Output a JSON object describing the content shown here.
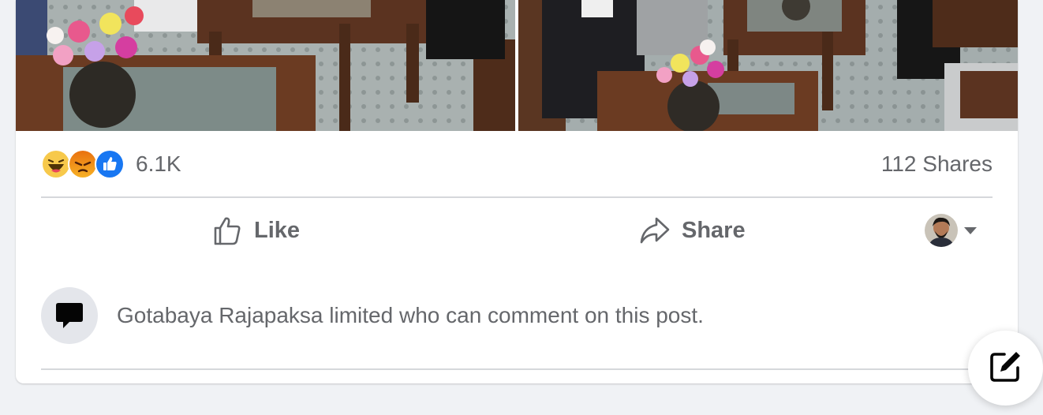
{
  "post": {
    "photos": [
      {
        "icon": "photo-meeting-room-left"
      },
      {
        "icon": "photo-meeting-room-right"
      }
    ],
    "reactions": {
      "icons": [
        "haha-reaction-icon",
        "angry-reaction-icon",
        "like-reaction-icon"
      ],
      "count": "6.1K"
    },
    "shares": "112 Shares",
    "actions": {
      "like_label": "Like",
      "share_label": "Share"
    },
    "comment_notice": "Gotabaya Rajapaksa limited who can comment on this post."
  },
  "colors": {
    "page_background": "#f0f2f5",
    "card_background": "#ffffff",
    "secondary_text": "#65676b",
    "like_blue": "#1877f2",
    "haha_yellow": "#f7c94b",
    "angry_orange": "#e9710f"
  }
}
